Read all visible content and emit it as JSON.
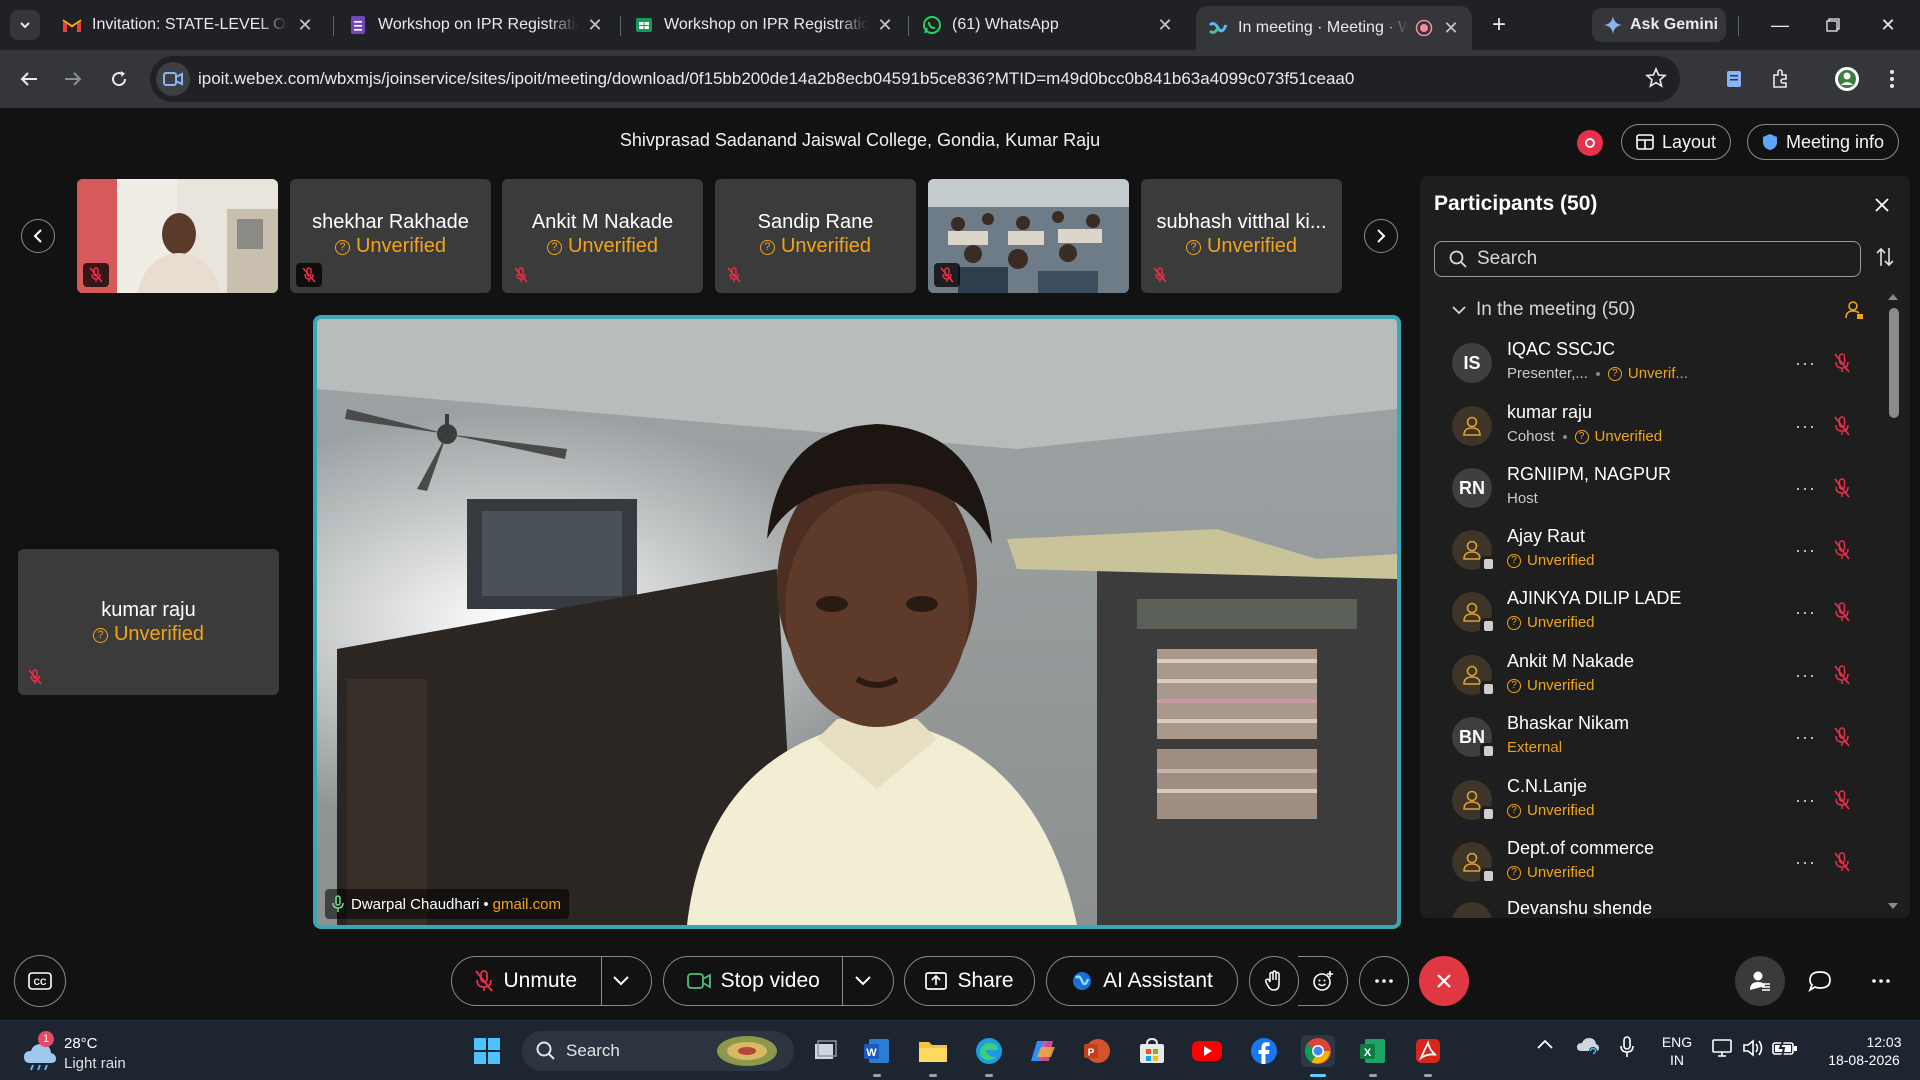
{
  "browser": {
    "tabs": [
      {
        "title": "Invitation: STATE-LEVEL ONLINE",
        "icon": "gmail-icon"
      },
      {
        "title": "Workshop on IPR Registration",
        "icon": "forms-icon"
      },
      {
        "title": "Workshop on IPR Registration",
        "icon": "sheets-icon"
      },
      {
        "title": "(61) WhatsApp",
        "icon": "whatsapp-icon"
      },
      {
        "title": "In meeting · Meeting · Webex",
        "icon": "webex-icon",
        "active": true
      }
    ],
    "gemini_label": "Ask Gemini",
    "url": "ipoit.webex.com/wbxmjs/joinservice/sites/ipoit/meeting/download/0f15bb200de14a2b8ecb04591b5ce836?MTID=m49d0bcc0b841b63a4099c073f51ceaa0"
  },
  "meeting": {
    "title": "Shivprasad Sadanand Jaiswal College, Gondia, Kumar Raju",
    "layout_label": "Layout",
    "info_label": "Meeting info"
  },
  "filmstrip": [
    {
      "name": "",
      "unverified": "",
      "video": true
    },
    {
      "name": "shekhar Rakhade",
      "unverified": "Unverified"
    },
    {
      "name": "Ankit M Nakade",
      "unverified": "Unverified"
    },
    {
      "name": "Sandip Rane",
      "unverified": "Unverified"
    },
    {
      "name": "",
      "unverified": "",
      "video": true
    },
    {
      "name": "subhash vitthal ki...",
      "unverified": "Unverified"
    }
  ],
  "side_tile": {
    "name": "kumar raju",
    "unverified": "Unverified"
  },
  "speaker": {
    "name": "Dwarpal Chaudhari",
    "domain": "gmail.com"
  },
  "participants": {
    "title": "Participants (50)",
    "search_placeholder": "Search",
    "section": "In the meeting (50)",
    "list": [
      {
        "initials": "IS",
        "name": "IQAC SSCJC",
        "role": "Presenter,...",
        "status": "Unverif..."
      },
      {
        "initials": "",
        "name": "kumar raju",
        "role": "Cohost",
        "status": "Unverified"
      },
      {
        "initials": "RN",
        "name": "RGNIIPM, NAGPUR",
        "role": "Host",
        "status": ""
      },
      {
        "initials": "",
        "name": "Ajay Raut",
        "role": "",
        "status": "Unverified"
      },
      {
        "initials": "",
        "name": "AJINKYA DILIP LADE",
        "role": "",
        "status": "Unverified"
      },
      {
        "initials": "",
        "name": "Ankit M Nakade",
        "role": "",
        "status": "Unverified"
      },
      {
        "initials": "BN",
        "name": "Bhaskar Nikam",
        "role": "",
        "status": "External"
      },
      {
        "initials": "",
        "name": "C.N.Lanje",
        "role": "",
        "status": "Unverified"
      },
      {
        "initials": "",
        "name": "Dept.of commerce",
        "role": "",
        "status": "Unverified"
      },
      {
        "initials": "",
        "name": "Devanshu shende",
        "role": "",
        "status": ""
      }
    ]
  },
  "controls": {
    "unmute": "Unmute",
    "stop_video": "Stop video",
    "share": "Share",
    "ai_assistant": "AI Assistant"
  },
  "taskbar": {
    "weather_temp": "28°C",
    "weather_desc": "Light rain",
    "weather_badge": "1",
    "search": "Search",
    "lang1": "ENG",
    "lang2": "IN",
    "time": "12:03",
    "date": "18-08-2026"
  },
  "colors": {
    "accent_teal": "#3ba7b4",
    "unverified": "#f2a516",
    "end_call": "#e03843",
    "mute_red": "#e8304a"
  }
}
